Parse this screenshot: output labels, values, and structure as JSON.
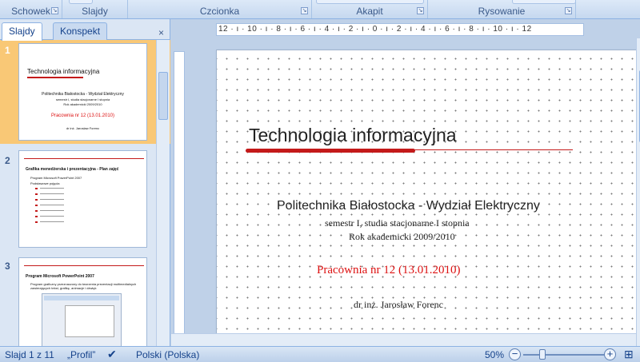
{
  "ribbon": {
    "groups": [
      {
        "label": "Schowek"
      },
      {
        "label": "Slajdy"
      },
      {
        "label": "Czcionka"
      },
      {
        "label": "Akapit"
      },
      {
        "label": "Rysowanie"
      }
    ]
  },
  "panel": {
    "tabs": [
      "Slajdy",
      "Konspekt"
    ],
    "active_tab": "Slajdy",
    "close_icon": "×",
    "thumbnails": [
      {
        "number": "1",
        "title": "Technologia informacyjna",
        "lines": [
          "Politechnika Białostocka - Wydział Elektryczny",
          "semestr I, studia stacjonarne I stopnia",
          "Rok akademicki 2009/2010"
        ],
        "red": "Pracownia nr 12 (13.01.2010)",
        "author": "dr inż. Jarosław Forenc"
      },
      {
        "number": "2",
        "heading": "Grafika menedżerska i prezentacyjna - Plan zajęć",
        "bullets": [
          "Program Microsoft PowerPoint 2007",
          "Podstawowe pojęcia"
        ]
      },
      {
        "number": "3",
        "heading": "Program Microsoft PowerPoint 2007",
        "bullets": [
          "Program graficzny przeznaczony do tworzenia prezentacji multimedialnych zawierających tekst, grafikę, animacje i dźwięk"
        ]
      }
    ]
  },
  "ruler": {
    "horizontal": "12 · ı · 10 · ı · 8 · ı · 6 · ı · 4 · ı · 2 · ı · 0 · ı · 2 · ı · 4 · ı · 6 · ı · 8 · ı · 10 · ı · 12"
  },
  "slide": {
    "title": "Technologia informacyjna",
    "institution": "Politechnika Białostocka - Wydział Elektryczny",
    "line2": "semestr I, studia stacjonarne I stopnia",
    "line3": "Rok akademicki 2009/2010",
    "lab": "Pracownia nr 12 (13.01.2010)",
    "author": "dr inż. Jarosław Forenc"
  },
  "status": {
    "slide_count": "Slajd 1 z 11",
    "theme": "„Profil”",
    "language": "Polski (Polska)",
    "zoom": "50%",
    "minus": "−",
    "plus": "+"
  },
  "colors": {
    "accent_red": "#c41a1a",
    "selection": "#f9c876",
    "ribbon": "#c5d8ef"
  }
}
